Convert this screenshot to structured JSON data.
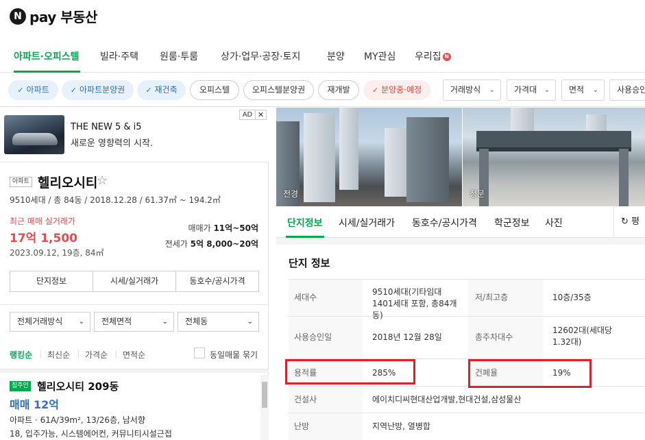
{
  "header": {
    "logo_n": "N",
    "logo_text": "pay 부동산"
  },
  "nav": {
    "items": [
      "아파트·오피스텔",
      "빌라·주택",
      "원룸·투룸",
      "상가·업무·공장·토지",
      "분양",
      "MY관심",
      "우리집"
    ],
    "new_badge": "N"
  },
  "filters": {
    "chips": [
      "아파트",
      "아파트분양권",
      "재건축",
      "오피스텔",
      "오피스텔분양권",
      "재개발",
      "분양중·예정"
    ],
    "check": "✓",
    "dropdowns": [
      "거래방식",
      "가격대",
      "면적",
      "사용승인"
    ]
  },
  "ad": {
    "tag": "AD",
    "close": "✕",
    "title": "THE NEW 5 & i5",
    "subtitle": "새로운 영향력의 시작."
  },
  "complex": {
    "type_tag": "아파트",
    "name": "헬리오시티",
    "star": "☆",
    "info": "9510세대 / 총 84동 / 2018.12.28 / 61.37㎡ ~ 194.2㎡",
    "recent_label": "최근 매매 실거래가",
    "recent_price": "17억 1,500",
    "recent_date": "2023.09.12, 19층, 84㎡",
    "sale_label": "매매가",
    "sale_range": "11억~50억",
    "jeonse_label": "전세가",
    "jeonse_range": "5억 8,000~20억",
    "tabs": [
      "단지정보",
      "시세/실거래가",
      "동호수/공시가격"
    ]
  },
  "list_filters": [
    "전체거래방식",
    "전체면적",
    "전체동"
  ],
  "sort": {
    "options": [
      "랭킹순",
      "최신순",
      "가격순",
      "면적순"
    ],
    "same_listing": "동일매물 묶기"
  },
  "listing": {
    "tag": "집주인",
    "name": "헬리오시티 209동",
    "price": "매매 12억",
    "detail1": "아파트 · 61A/39m², 13/26층, 남서향",
    "detail2": "18, 입주가능, 시스템에어컨, 커뮤니티시설근접"
  },
  "photos": {
    "caption1": "전경",
    "caption2": "정문"
  },
  "detail_tabs": {
    "items": [
      "단지정보",
      "시세/실거래가",
      "동호수/공시가격",
      "학군정보",
      "사진"
    ],
    "refresh": "↻ 평"
  },
  "info_section": {
    "title": "단지 정보",
    "rows": [
      {
        "l1": "세대수",
        "v1": "9510세대(기타임대 1401세대 포함, 총84개동)",
        "l2": "저/최고층",
        "v2": "10층/35층"
      },
      {
        "l1": "사용승인일",
        "v1": "2018년 12월 28일",
        "l2": "총주차대수",
        "v2": "12602대(세대당 1.32대)"
      },
      {
        "l1": "용적률",
        "v1": "285%",
        "l2": "건폐율",
        "v2": "19%"
      },
      {
        "l1": "건설사",
        "v1": "에이치디씨현대산업개발,현대건설,삼성물산"
      },
      {
        "l1": "난방",
        "v1": "지역난방, 열병합"
      }
    ]
  },
  "colors": {
    "accent": "#03a94d",
    "price_red": "#e84a4a",
    "price_blue": "#2f6ecb",
    "highlight": "#e21e2a"
  }
}
